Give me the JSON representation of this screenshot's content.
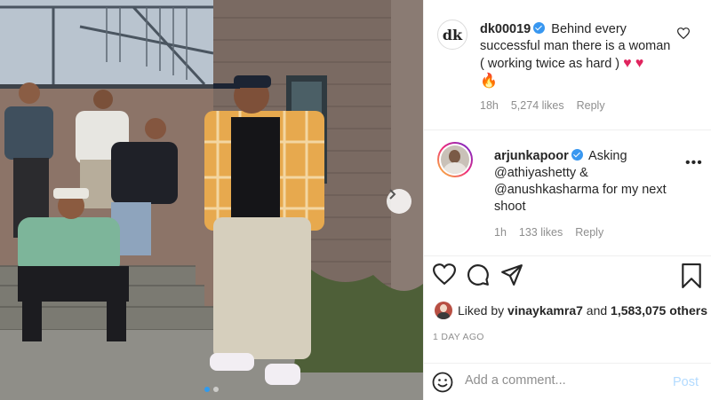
{
  "photo": {
    "slides": 2,
    "active_slide": 1
  },
  "comments": [
    {
      "username": "dk00019",
      "text_line1": "Behind every",
      "text_line2": "successful man there is a woman",
      "text_line3": "( working twice as hard )",
      "emojis": "❤️❤️🔥",
      "time": "18h",
      "likes": "5,274 likes",
      "reply": "Reply",
      "avatar_text": "dk"
    },
    {
      "username": "arjunkapoor",
      "text_line1": "Asking",
      "text_line2": "@athiyashetty &",
      "text_line3": "@anushkasharma for my next",
      "text_line4": "shoot",
      "time": "1h",
      "likes": "133 likes",
      "reply": "Reply"
    }
  ],
  "liked_by": {
    "prefix": "Liked by ",
    "user": "vinaykamra7",
    "middle": " and ",
    "count": "1,583,075 others"
  },
  "timestamp": "1 DAY AGO",
  "add_comment": {
    "placeholder": "Add a comment...",
    "post_label": "Post"
  },
  "colors": {
    "verified": "#3897f0",
    "post_disabled": "#b3dbff",
    "slide_dot_active": "#2f9bf0"
  }
}
